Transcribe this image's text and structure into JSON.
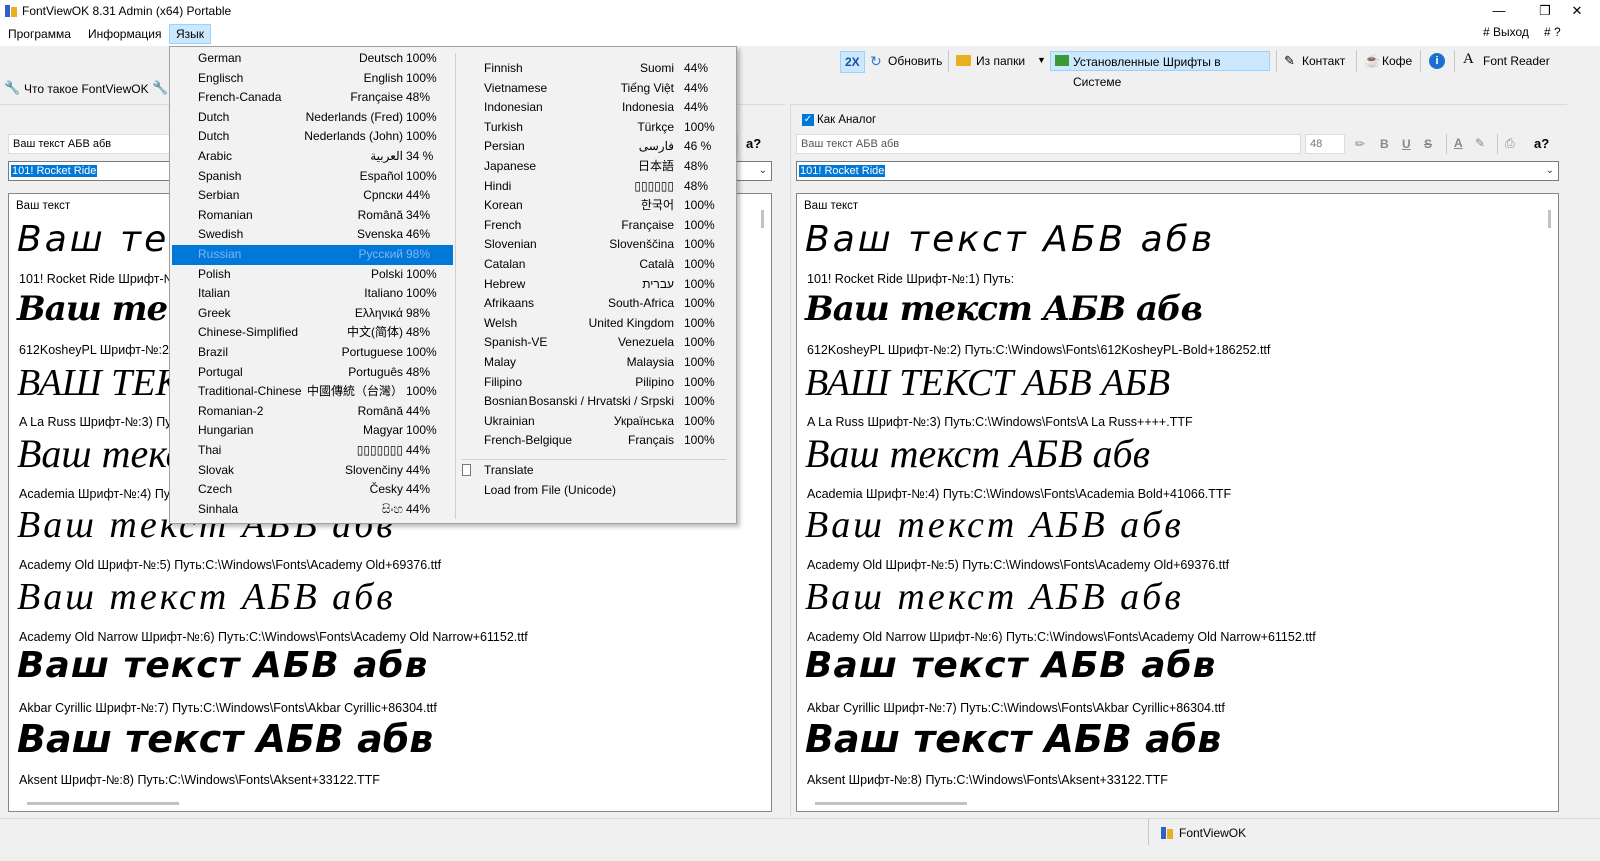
{
  "title": "FontViewOK 8.31 Admin (x64) Portable",
  "menu": {
    "items": [
      "Программа",
      "Информация",
      "Язык"
    ],
    "exit": "# Выход",
    "help": "# ?"
  },
  "toolbar": {
    "x2": "2X",
    "refresh": "Обновить",
    "from_folder": "Из папки",
    "installed": "Установленные Шрифты в Системе",
    "contact": "Контакт",
    "coffee": "Кофе",
    "font_reader": "Font Reader",
    "what_is": "Что такое FontViewOK"
  },
  "left": {
    "sample_text": "Ваш текст АБВ абв",
    "font": "101! Rocket Ride",
    "header": "Ваш текст",
    "query": "a?"
  },
  "right": {
    "analog_label": "Как Аналог",
    "sample_text": "Ваш текст АБВ абв",
    "size": "48",
    "font": "101! Rocket Ride",
    "header": "Ваш текст",
    "query": "a?"
  },
  "left_samples": [
    {
      "sample": "Ваш текст АБВ абв",
      "caption": "101! Rocket Ride Шрифт-№:1) Путь:"
    },
    {
      "sample": "Ваш текст АБВ абв",
      "caption": "612KosheyPL Шрифт-№:2) Путь:C:\\Windows\\Fonts\\612KosheyPL-Bold+186252.ttf"
    },
    {
      "sample": "ВАШ ТЕКСТ АБВ АБВ",
      "caption": "A La Russ Шрифт-№:3) Путь:C:\\Windows\\Fonts\\A La Russ++++.TTF"
    },
    {
      "sample": "Ваш текст АБВ абв",
      "caption": "Academia Шрифт-№:4) Путь:C:\\Windows\\Fonts\\Academia Bold+41066.TTF"
    },
    {
      "sample": "Ваш текст АБВ абв",
      "caption": "Academy Old Шрифт-№:5) Путь:C:\\Windows\\Fonts\\Academy Old+69376.ttf"
    },
    {
      "sample": "Ваш текст АБВ абв",
      "caption": "Academy Old Narrow Шрифт-№:6) Путь:C:\\Windows\\Fonts\\Academy Old Narrow+61152.ttf"
    },
    {
      "sample": "Ваш текст АБВ абв",
      "caption": "Akbar Cyrillic Шрифт-№:7) Путь:C:\\Windows\\Fonts\\Akbar Cyrillic+86304.ttf"
    },
    {
      "sample": "Ваш текст АБВ абв",
      "caption": "Aksent Шрифт-№:8) Путь:C:\\Windows\\Fonts\\Aksent+33122.TTF"
    }
  ],
  "right_samples": [
    {
      "sample": "Ваш текст АБВ абв",
      "caption": "101! Rocket Ride Шрифт-№:1) Путь:"
    },
    {
      "sample": "Ваш текст АБВ абв",
      "caption": "612KosheyPL Шрифт-№:2) Путь:C:\\Windows\\Fonts\\612KosheyPL-Bold+186252.ttf"
    },
    {
      "sample": "ВАШ ТЕКСТ АБВ АБВ",
      "caption": "A La Russ Шрифт-№:3) Путь:C:\\Windows\\Fonts\\A La Russ++++.TTF"
    },
    {
      "sample": "Ваш текст АБВ абв",
      "caption": "Academia Шрифт-№:4) Путь:C:\\Windows\\Fonts\\Academia Bold+41066.TTF"
    },
    {
      "sample": "Ваш текст АБВ абв",
      "caption": "Academy Old Шрифт-№:5) Путь:C:\\Windows\\Fonts\\Academy Old+69376.ttf"
    },
    {
      "sample": "Ваш текст АБВ абв",
      "caption": "Academy Old Narrow Шрифт-№:6) Путь:C:\\Windows\\Fonts\\Academy Old Narrow+61152.ttf"
    },
    {
      "sample": "Ваш текст АБВ абв",
      "caption": "Akbar Cyrillic Шрифт-№:7) Путь:C:\\Windows\\Fonts\\Akbar Cyrillic+86304.ttf"
    },
    {
      "sample": "Ваш текст АБВ абв",
      "caption": "Aksent Шрифт-№:8) Путь:C:\\Windows\\Fonts\\Aksent+33122.TTF"
    }
  ],
  "languages_col1": [
    {
      "en": "German",
      "native": "Deutsch",
      "pct": "100%"
    },
    {
      "en": "Englisch",
      "native": "English",
      "pct": "100%"
    },
    {
      "en": "French-Canada",
      "native": "Française",
      "pct": "48%"
    },
    {
      "en": "Dutch",
      "native": "Nederlands (Fred)",
      "pct": "100%"
    },
    {
      "en": "Dutch",
      "native": "Nederlands (John)",
      "pct": "100%"
    },
    {
      "en": "Arabic",
      "native": "العربية",
      "pct": "34 %"
    },
    {
      "en": "Spanish",
      "native": "Español",
      "pct": "100%"
    },
    {
      "en": "Serbian",
      "native": "Српски",
      "pct": "44%"
    },
    {
      "en": "Romanian",
      "native": "Română",
      "pct": "34%"
    },
    {
      "en": "Swedish",
      "native": "Svenska",
      "pct": "46%"
    },
    {
      "en": "Russian",
      "native": "Русский",
      "pct": "98%"
    },
    {
      "en": "Polish",
      "native": "Polski",
      "pct": "100%"
    },
    {
      "en": "Italian",
      "native": "Italiano",
      "pct": "100%"
    },
    {
      "en": "Greek",
      "native": "Ελληνικά",
      "pct": "98%"
    },
    {
      "en": "Chinese-Simplified",
      "native": "中文(简体)",
      "pct": "48%"
    },
    {
      "en": "Brazil",
      "native": "Portuguese",
      "pct": "100%"
    },
    {
      "en": "Portugal",
      "native": "Português",
      "pct": "48%"
    },
    {
      "en": "Traditional-Chinese",
      "native": "中國傳統（台灣）",
      "pct": "100%"
    },
    {
      "en": "Romanian-2",
      "native": "Română",
      "pct": "44%"
    },
    {
      "en": "Hungarian",
      "native": "Magyar",
      "pct": "100%"
    },
    {
      "en": "Thai",
      "native": "▯▯▯▯▯▯▯",
      "pct": "44%"
    },
    {
      "en": "Slovak",
      "native": "Slovenčiny",
      "pct": "44%"
    },
    {
      "en": "Czech",
      "native": "Česky",
      "pct": "44%"
    },
    {
      "en": "Sinhala",
      "native": "සිංහ",
      "pct": "44%"
    }
  ],
  "languages_col2": [
    {
      "en": "Finnish",
      "native": "Suomi",
      "pct": "44%"
    },
    {
      "en": "Vietnamese",
      "native": "Tiếng Việt",
      "pct": "44%"
    },
    {
      "en": "Indonesian",
      "native": "Indonesia",
      "pct": "44%"
    },
    {
      "en": "Turkish",
      "native": "Türkçe",
      "pct": "100%"
    },
    {
      "en": "Persian",
      "native": "فارسی",
      "pct": "46 %"
    },
    {
      "en": "Japanese",
      "native": "日本語",
      "pct": "48%"
    },
    {
      "en": "Hindi",
      "native": "▯▯▯▯▯▯",
      "pct": "48%"
    },
    {
      "en": "Korean",
      "native": "한국어",
      "pct": "100%"
    },
    {
      "en": "French",
      "native": "Française",
      "pct": "100%"
    },
    {
      "en": "Slovenian",
      "native": "Slovenščina",
      "pct": "100%"
    },
    {
      "en": "Catalan",
      "native": "Català",
      "pct": "100%"
    },
    {
      "en": "Hebrew",
      "native": "עברית",
      "pct": "100%"
    },
    {
      "en": "Afrikaans",
      "native": "South-Africa",
      "pct": "100%"
    },
    {
      "en": "Welsh",
      "native": "United Kingdom",
      "pct": "100%"
    },
    {
      "en": "Spanish-VE",
      "native": "Venezuela",
      "pct": "100%"
    },
    {
      "en": "Malay",
      "native": "Malaysia",
      "pct": "100%"
    },
    {
      "en": "Filipino",
      "native": "Pilipino",
      "pct": "100%"
    },
    {
      "en": "Bosnian",
      "native": "Bosanski / Hrvatski / Srpski",
      "pct": "100%"
    },
    {
      "en": "Ukrainian",
      "native": "Українська",
      "pct": "100%"
    },
    {
      "en": "French-Belgique",
      "native": "Français",
      "pct": "100%"
    }
  ],
  "menu_extra": {
    "translate": "Translate",
    "load_file": "Load from File (Unicode)"
  },
  "status": {
    "app": "FontViewOK"
  },
  "colors": {
    "highlight": "#0078d7",
    "active_menu": "#cce8ff"
  }
}
